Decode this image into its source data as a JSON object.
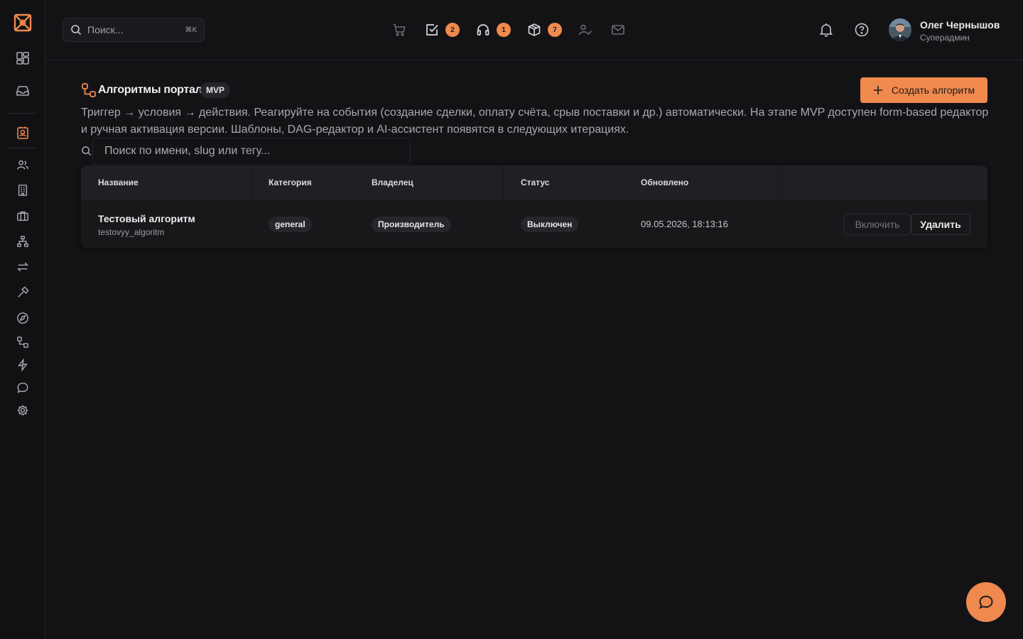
{
  "header": {
    "search_placeholder": "Поиск...",
    "shortcut": "⌘K",
    "badges": {
      "tasks": "2",
      "support": "1",
      "packages": "7"
    },
    "user": {
      "name": "Олег Чернышов",
      "role": "Суперадмин"
    }
  },
  "sidebar": {
    "items": [
      "dashboard",
      "inbox",
      "contacts",
      "users",
      "buildings",
      "briefcase",
      "org-structure",
      "exchange",
      "hammer",
      "compass",
      "algorithms",
      "lightning",
      "chat",
      "settings"
    ],
    "active": "contacts"
  },
  "page": {
    "title": "Алгоритмы портала",
    "badge": "MVP",
    "create_label": "Создать алгоритм",
    "description": "Триггер → условия → действия. Реагируйте на события (создание сделки, оплату счёта, срыв поставки и др.) автоматически. На этапе MVP доступен form-based редактор и ручная активация версии. Шаблоны, DAG-редактор и AI-ассистент появятся в следующих итерациях.",
    "search_placeholder": "Поиск по имени, slug или тегу..."
  },
  "table": {
    "columns": [
      "Название",
      "Категория",
      "Владелец",
      "Статус",
      "Обновлено"
    ],
    "rows": [
      {
        "name": "Тестовый алгоритм",
        "slug": "testovyy_algoritm",
        "category": "general",
        "owner": "Производитель",
        "status": "Выключен",
        "updated": "09.05.2026, 18:13:16",
        "enable_label": "Включить",
        "delete_label": "Удалить"
      }
    ]
  },
  "colors": {
    "accent": "#f0894d",
    "background": "#131316",
    "surface": "#18181b"
  }
}
